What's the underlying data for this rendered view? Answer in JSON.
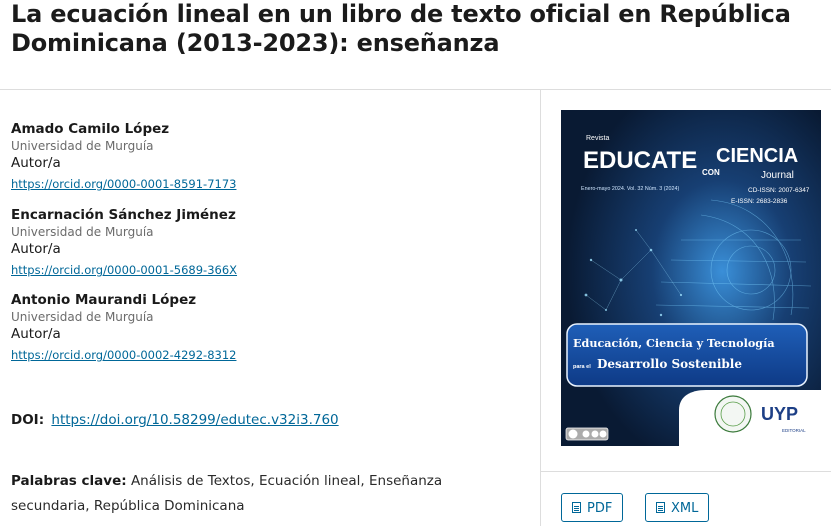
{
  "article": {
    "title": "La ecuación lineal en un libro de texto oficial en República Dominicana (2013-2023): enseñanza"
  },
  "authors": [
    {
      "name": "Amado Camilo López",
      "affiliation": "Universidad de Murguía",
      "role": "Autor/a",
      "orcid": "https://orcid.org/0000-0001-8591-7173"
    },
    {
      "name": "Encarnación Sánchez Jiménez",
      "affiliation": "Universidad de Murguía",
      "role": "Autor/a",
      "orcid": "https://orcid.org/0000-0001-5689-366X"
    },
    {
      "name": "Antonio Maurandi López",
      "affiliation": "Universidad de Murguía",
      "role": "Autor/a",
      "orcid": "https://orcid.org/0000-0002-4292-8312"
    }
  ],
  "doi": {
    "label": "DOI:",
    "value": "https://doi.org/10.58299/edutec.v32i3.760"
  },
  "keywords": {
    "label": "Palabras clave:",
    "value": "Análisis de Textos, Ecuación lineal, Enseñanza secundaria, República Dominicana"
  },
  "cover": {
    "revista": "Revista",
    "brand_left": "EDUCATE",
    "brand_con": "CON",
    "brand_right": "CIENCIA",
    "journal": "Journal",
    "issue": "Enero-mayo 2024. Vol. 32 Núm. 3 (2024)",
    "cd_issn": "CD-ISSN: 2007-6347",
    "e_issn": "E-ISSN: 2683-2836",
    "tagline_1": "Educación, Ciencia y Tecnología",
    "tagline_para": "para el",
    "tagline_2": "Desarrollo Sostenible",
    "publisher": "UYP",
    "publisher_sub": "EDITORIAL"
  },
  "galleys": [
    {
      "label": "PDF",
      "icon": "file-icon"
    },
    {
      "label": "XML",
      "icon": "file-icon"
    }
  ],
  "colors": {
    "link": "#006798",
    "cover_bg": "#0b1f3a",
    "cover_title": "#ffffff"
  }
}
